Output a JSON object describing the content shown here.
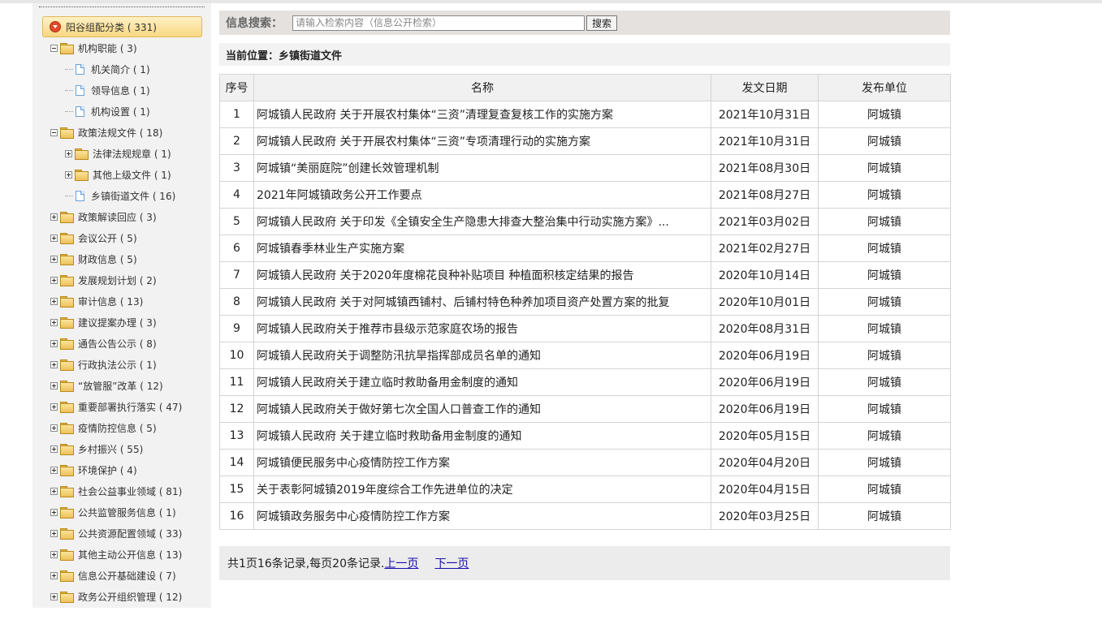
{
  "sidebar": {
    "root": "阳谷组配分类 ( 331)",
    "items": [
      {
        "label": "机构职能 ( 3)",
        "level": 1,
        "kind": "folder",
        "expander": "minus"
      },
      {
        "label": "机关简介 ( 1)",
        "level": 2,
        "kind": "doc"
      },
      {
        "label": "领导信息 ( 1)",
        "level": 2,
        "kind": "doc"
      },
      {
        "label": "机构设置 ( 1)",
        "level": 2,
        "kind": "doc"
      },
      {
        "label": "政策法规文件 ( 18)",
        "level": 1,
        "kind": "folder",
        "expander": "minus"
      },
      {
        "label": "法律法规规章 ( 1)",
        "level": 2,
        "kind": "folder",
        "expander": "plus"
      },
      {
        "label": "其他上级文件 ( 1)",
        "level": 2,
        "kind": "folder",
        "expander": "plus"
      },
      {
        "label": "乡镇街道文件 ( 16)",
        "level": 2,
        "kind": "doc"
      },
      {
        "label": "政策解读回应 ( 3)",
        "level": 0,
        "kind": "folder",
        "expander": "plus"
      },
      {
        "label": "会议公开 ( 5)",
        "level": 0,
        "kind": "folder",
        "expander": "plus"
      },
      {
        "label": "财政信息 ( 5)",
        "level": 0,
        "kind": "folder",
        "expander": "plus"
      },
      {
        "label": "发展规划计划 ( 2)",
        "level": 0,
        "kind": "folder",
        "expander": "plus"
      },
      {
        "label": "审计信息 ( 13)",
        "level": 0,
        "kind": "folder",
        "expander": "plus"
      },
      {
        "label": "建议提案办理 ( 3)",
        "level": 0,
        "kind": "folder",
        "expander": "plus"
      },
      {
        "label": "通告公告公示 ( 8)",
        "level": 0,
        "kind": "folder",
        "expander": "plus"
      },
      {
        "label": "行政执法公示 ( 1)",
        "level": 0,
        "kind": "folder",
        "expander": "plus"
      },
      {
        "label": "“放管服”改革 ( 12)",
        "level": 0,
        "kind": "folder",
        "expander": "plus"
      },
      {
        "label": "重要部署执行落实 ( 47)",
        "level": 0,
        "kind": "folder",
        "expander": "plus"
      },
      {
        "label": "疫情防控信息 ( 5)",
        "level": 0,
        "kind": "folder",
        "expander": "plus"
      },
      {
        "label": "乡村振兴 ( 55)",
        "level": 0,
        "kind": "folder",
        "expander": "plus"
      },
      {
        "label": "环境保护 ( 4)",
        "level": 0,
        "kind": "folder",
        "expander": "plus"
      },
      {
        "label": "社会公益事业领域 ( 81)",
        "level": 0,
        "kind": "folder",
        "expander": "plus"
      },
      {
        "label": "公共监管服务信息 ( 1)",
        "level": 0,
        "kind": "folder",
        "expander": "plus"
      },
      {
        "label": "公共资源配置领域 ( 33)",
        "level": 0,
        "kind": "folder",
        "expander": "plus"
      },
      {
        "label": "其他主动公开信息 ( 13)",
        "level": 0,
        "kind": "folder",
        "expander": "plus"
      },
      {
        "label": "信息公开基础建设 ( 7)",
        "level": 0,
        "kind": "folder",
        "expander": "plus"
      },
      {
        "label": "政务公开组织管理 ( 12)",
        "level": 0,
        "kind": "folder",
        "expander": "plus"
      }
    ]
  },
  "search": {
    "label": "信息搜索：",
    "placeholder": "请输入检索内容（信息公开检索）",
    "button": "搜索"
  },
  "location": "当前位置：乡镇街道文件",
  "table": {
    "headers": [
      "序号",
      "名称",
      "发文日期",
      "发布单位"
    ],
    "rows": [
      [
        "1",
        "阿城镇人民政府 关于开展农村集体“三资”清理复查复核工作的实施方案",
        "2021年10月31日",
        "阿城镇"
      ],
      [
        "2",
        "阿城镇人民政府 关于开展农村集体“三资”专项清理行动的实施方案",
        "2021年10月31日",
        "阿城镇"
      ],
      [
        "3",
        "阿城镇“美丽庭院”创建长效管理机制",
        "2021年08月30日",
        "阿城镇"
      ],
      [
        "4",
        "2021年阿城镇政务公开工作要点",
        "2021年08月27日",
        "阿城镇"
      ],
      [
        "5",
        "阿城镇人民政府 关于印发《全镇安全生产隐患大排查大整治集中行动实施方案》...",
        "2021年03月02日",
        "阿城镇"
      ],
      [
        "6",
        "阿城镇春季林业生产实施方案",
        "2021年02月27日",
        "阿城镇"
      ],
      [
        "7",
        "阿城镇人民政府 关于2020年度棉花良种补贴项目 种植面积核定结果的报告",
        "2020年10月14日",
        "阿城镇"
      ],
      [
        "8",
        "阿城镇人民政府 关于对阿城镇西铺村、后铺村特色种养加项目资产处置方案的批复",
        "2020年10月01日",
        "阿城镇"
      ],
      [
        "9",
        "阿城镇人民政府关于推荐市县级示范家庭农场的报告",
        "2020年08月31日",
        "阿城镇"
      ],
      [
        "10",
        "阿城镇人民政府关于调整防汛抗旱指挥部成员名单的通知",
        "2020年06月19日",
        "阿城镇"
      ],
      [
        "11",
        "阿城镇人民政府关于建立临时救助备用金制度的通知",
        "2020年06月19日",
        "阿城镇"
      ],
      [
        "12",
        "阿城镇人民政府关于做好第七次全国人口普查工作的通知",
        "2020年06月19日",
        "阿城镇"
      ],
      [
        "13",
        "阿城镇人民政府 关于建立临时救助备用金制度的通知",
        "2020年05月15日",
        "阿城镇"
      ],
      [
        "14",
        "阿城镇便民服务中心疫情防控工作方案",
        "2020年04月20日",
        "阿城镇"
      ],
      [
        "15",
        "关于表彰阿城镇2019年度综合工作先进单位的决定",
        "2020年04月15日",
        "阿城镇"
      ],
      [
        "16",
        "阿城镇政务服务中心疫情防控工作方案",
        "2020年03月25日",
        "阿城镇"
      ]
    ]
  },
  "pager": {
    "summary": "共1页16条记录,每页20条记录.",
    "prev": "上一页",
    "next": "下一页"
  }
}
